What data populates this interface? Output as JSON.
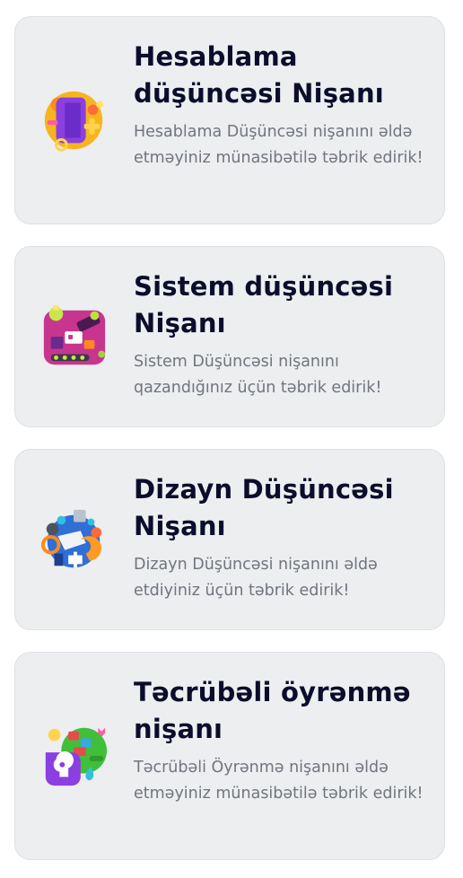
{
  "badges": [
    {
      "icon": "computational-thinking-badge-icon",
      "title": "Hesablama düşüncəsi Nişanı",
      "description": "Hesablama Düşüncəsi nişanını əldə etməyiniz münasibətilə təbrik edirik!"
    },
    {
      "icon": "systems-thinking-badge-icon",
      "title": "Sistem düşüncəsi Nişanı",
      "description": "Sistem Düşüncəsi nişanını qazandığınız üçün təbrik edirik!"
    },
    {
      "icon": "design-thinking-badge-icon",
      "title": "Dizayn Düşüncəsi Nişanı",
      "description": "Dizayn Düşüncəsi nişanını əldə etdiyiniz üçün təbrik edirik!"
    },
    {
      "icon": "experiential-learning-badge-icon",
      "title": "Təcrübəli öyrənmə nişanı",
      "description": "Təcrübəli Öyrənmə nişanını əldə etməyiniz münasibətilə təbrik edirik!"
    }
  ]
}
